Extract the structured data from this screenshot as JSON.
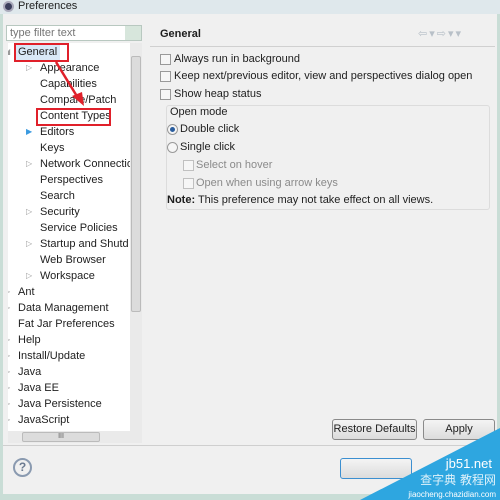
{
  "window": {
    "title": "Preferences"
  },
  "filter": {
    "placeholder": "type filter text"
  },
  "tree": [
    {
      "label": "General",
      "level": 0,
      "expander": "expanded"
    },
    {
      "label": "Appearance",
      "level": 1,
      "expander": "collapsed"
    },
    {
      "label": "Capabilities",
      "level": 1,
      "expander": "none"
    },
    {
      "label": "Compare/Patch",
      "level": 1,
      "expander": "none"
    },
    {
      "label": "Content Types",
      "level": 1,
      "expander": "none"
    },
    {
      "label": "Editors",
      "level": 1,
      "expander": "collapsed-blue"
    },
    {
      "label": "Keys",
      "level": 1,
      "expander": "none"
    },
    {
      "label": "Network Connectio",
      "level": 1,
      "expander": "collapsed"
    },
    {
      "label": "Perspectives",
      "level": 1,
      "expander": "none"
    },
    {
      "label": "Search",
      "level": 1,
      "expander": "none"
    },
    {
      "label": "Security",
      "level": 1,
      "expander": "collapsed"
    },
    {
      "label": "Service Policies",
      "level": 1,
      "expander": "none"
    },
    {
      "label": "Startup and Shutd",
      "level": 1,
      "expander": "collapsed"
    },
    {
      "label": "Web Browser",
      "level": 1,
      "expander": "none"
    },
    {
      "label": "Workspace",
      "level": 1,
      "expander": "collapsed"
    },
    {
      "label": "Ant",
      "level": 0,
      "expander": "collapsed"
    },
    {
      "label": "Data Management",
      "level": 0,
      "expander": "collapsed"
    },
    {
      "label": "Fat Jar Preferences",
      "level": 0,
      "expander": "none"
    },
    {
      "label": "Help",
      "level": 0,
      "expander": "collapsed"
    },
    {
      "label": "Install/Update",
      "level": 0,
      "expander": "collapsed"
    },
    {
      "label": "Java",
      "level": 0,
      "expander": "collapsed"
    },
    {
      "label": "Java EE",
      "level": 0,
      "expander": "collapsed"
    },
    {
      "label": "Java Persistence",
      "level": 0,
      "expander": "collapsed"
    },
    {
      "label": "JavaScript",
      "level": 0,
      "expander": "collapsed"
    }
  ],
  "hscroll_grip": "III",
  "page": {
    "title": "General",
    "options": [
      {
        "label": "Always run in background",
        "checked": false
      },
      {
        "label": "Keep next/previous editor, view and perspectives dialog open",
        "checked": false
      },
      {
        "label": "Show heap status",
        "checked": false
      }
    ],
    "open_mode": {
      "label": "Open mode",
      "double_click": "Double click",
      "single_click": "Single click",
      "selected": "Double click",
      "select_on_hover": "Select on hover",
      "open_arrow_keys": "Open when using arrow keys"
    },
    "note_bold": "Note:",
    "note_text": " This preference may not take effect on all views.",
    "restore_defaults": "Restore Defaults",
    "apply": "Apply"
  },
  "help_glyph": "?",
  "annotation_color": "#e0202a",
  "watermark": {
    "line1": "jb51.net",
    "line2": "查字典 教程网",
    "line3": "jiaocheng.chazidian.com",
    "color": "#2ea6e0"
  }
}
